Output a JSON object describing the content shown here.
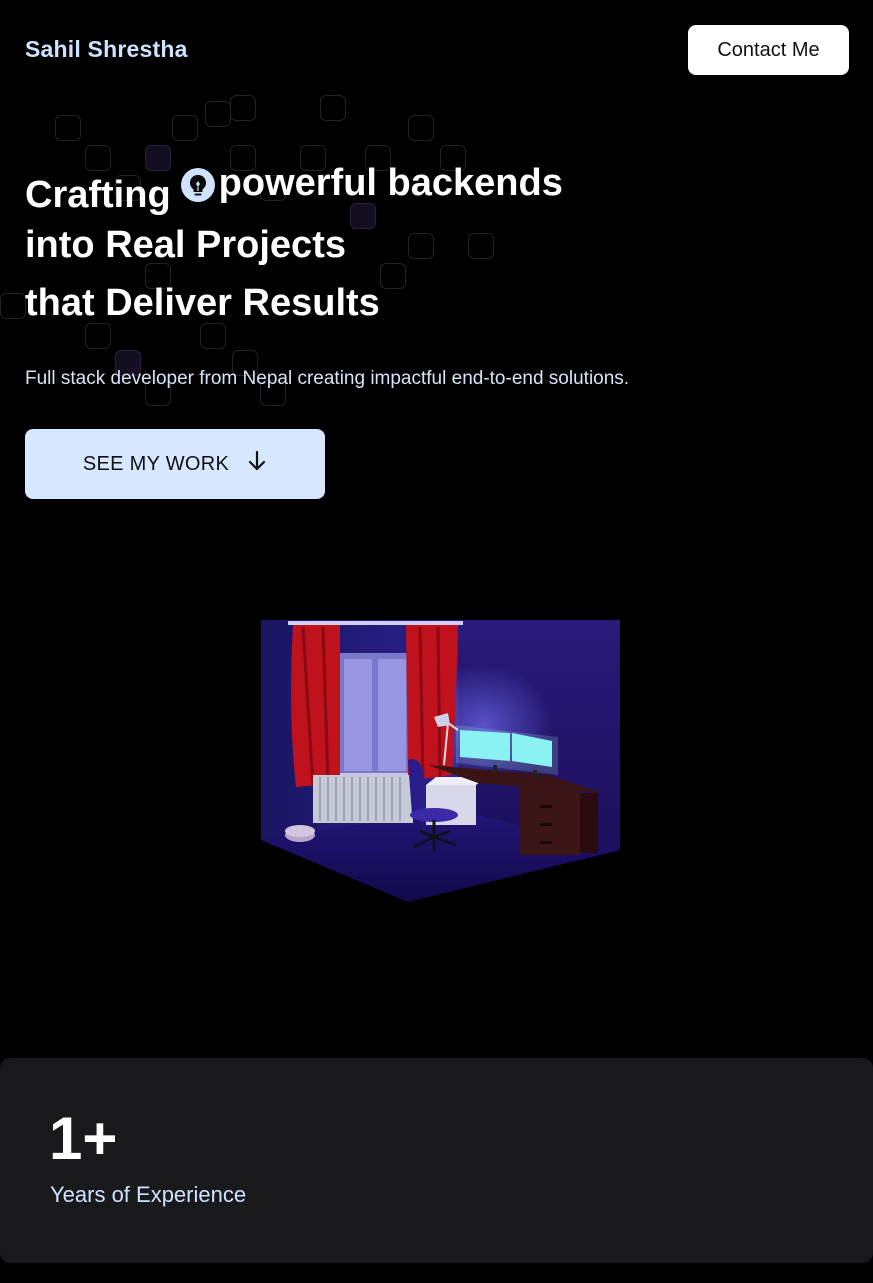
{
  "header": {
    "brand": "Sahil Shrestha",
    "contact_label": "Contact Me"
  },
  "hero": {
    "title_word_1": "Crafting",
    "title_highlight": "powerful backends",
    "title_line_2": "into Real Projects",
    "title_line_3": "that Deliver Results",
    "icon": "lightbulb-icon",
    "subtitle": "Full stack developer from Nepal creating impactful end-to-end solutions.",
    "cta_label": "SEE MY WORK",
    "cta_icon": "arrow-down-icon"
  },
  "illustration": {
    "name": "isometric-room-illustration"
  },
  "stats": {
    "value": "1+",
    "label": "Years of Experience"
  },
  "colors": {
    "background": "#000000",
    "accent": "#d6e7ff",
    "card": "#19191b",
    "text": "#ffffff"
  }
}
